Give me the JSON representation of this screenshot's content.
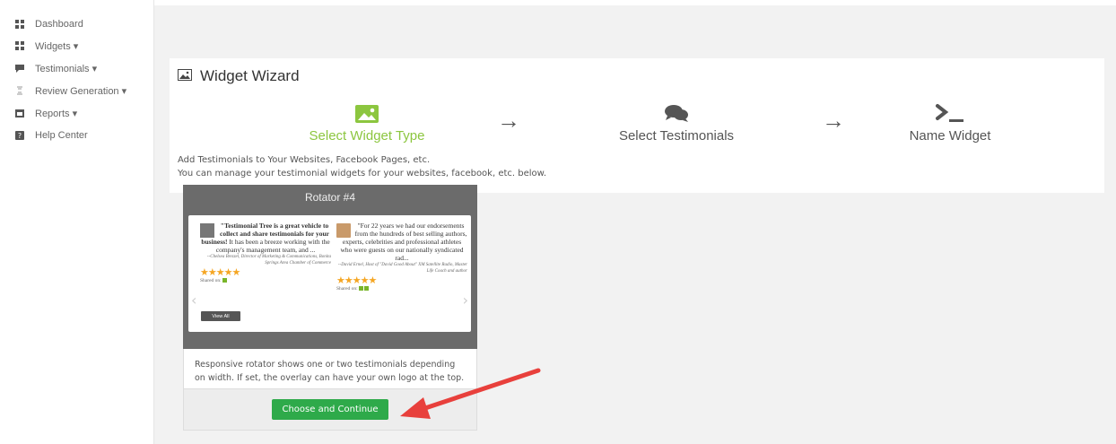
{
  "sidebar": {
    "items": [
      {
        "label": "Dashboard",
        "icon": "grid-icon"
      },
      {
        "label": "Widgets ▾",
        "icon": "grid-icon"
      },
      {
        "label": "Testimonials ▾",
        "icon": "comment-icon"
      },
      {
        "label": "Review Generation ▾",
        "icon": "review-icon"
      },
      {
        "label": "Reports ▾",
        "icon": "calendar-icon"
      },
      {
        "label": "Help Center",
        "icon": "help-icon"
      }
    ]
  },
  "wizard": {
    "title": "Widget Wizard",
    "steps": [
      {
        "label": "Select Widget Type",
        "icon": "image-icon",
        "color": "#8cc63f"
      },
      {
        "label": "Select Testimonials",
        "icon": "comments-icon",
        "color": "#555555"
      },
      {
        "label": "Name Widget",
        "icon": "terminal-icon",
        "color": "#555555"
      }
    ],
    "arrow": "→",
    "desc_line1": "Add Testimonials to Your Websites, Facebook Pages, etc.",
    "desc_line2": "You can manage your testimonial widgets for your websites, facebook, etc. below."
  },
  "card": {
    "title": "Rotator #4",
    "testimonial1": {
      "quote_bold": "\"Testimonial Tree is a great vehicle to collect and share testimonials for your business!",
      "quote_rest": " It has been a breeze working with the company's management team, and ...",
      "attribution": "--Chelsea Brezzel, Director of Marketing & Communications, Bonita Springs Area Chamber of Commerce",
      "stars": "★★★★★",
      "shared": "Shared on:",
      "view_all": "View All"
    },
    "testimonial2": {
      "quote": "\"For 22 years we had our endorsements from the hundreds of best selling authors, experts, celebrities and professional athletes who were guests on our nationally syndicated rad...",
      "attribution": "--David Ernel, Host of \"David Good About\" XM Satellite Radio, Master Life Coach and author",
      "stars": "★★★★★",
      "shared": "Shared on:"
    },
    "description": "Responsive rotator shows one or two testimonials depending on width. If set, the overlay can have your own logo at the top.",
    "button": "Choose and Continue"
  },
  "colors": {
    "accent": "#8cc63f",
    "button": "#2eaa4a",
    "annotation_arrow": "#e8403c"
  }
}
